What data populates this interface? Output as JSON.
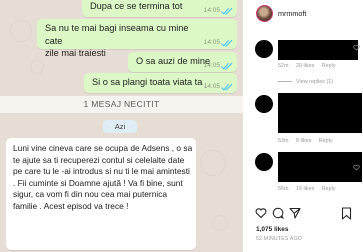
{
  "chat": {
    "outgoing": [
      {
        "text": "Dupa ce se termina tot",
        "time": "14:05"
      },
      {
        "line1": "Sa nu te mai bagi inseama cu mine cate",
        "line2": "zile mai traiesti",
        "time": "14:05"
      },
      {
        "text": "O sa auzi de mine",
        "time": "14:05"
      },
      {
        "text": "Si o sa plangi toata viata ta",
        "time": "14:05"
      }
    ],
    "unread_banner": "1 MESAJ NECITIT",
    "day_label": "Azi",
    "incoming_message": "Luni vine cineva care se ocupa de Adsens , o sa te ajute  sa ti recuperezi contul si celelalte date pe care tu le -ai introdus  si nu ti le mai amintesti . Fii cuminte si Doamne ajută ! Va  fi bine, sunt sigur, ca vom fi din nou cea mai puternica familie . Acest episod va trece !",
    "tick_color": "#4fc3f7"
  },
  "post": {
    "username": "mrmmoft",
    "comments": [
      {
        "age": "52m",
        "likes": "20 likes",
        "reply": "Reply",
        "view_replies": "View replies (1)"
      },
      {
        "age": "53m",
        "likes": "8 likes",
        "reply": "Reply"
      },
      {
        "age": "56m",
        "likes": "16 likes",
        "reply": "Reply"
      }
    ],
    "like_count": "1,075 likes",
    "date": "52 MINUTES AGO"
  }
}
